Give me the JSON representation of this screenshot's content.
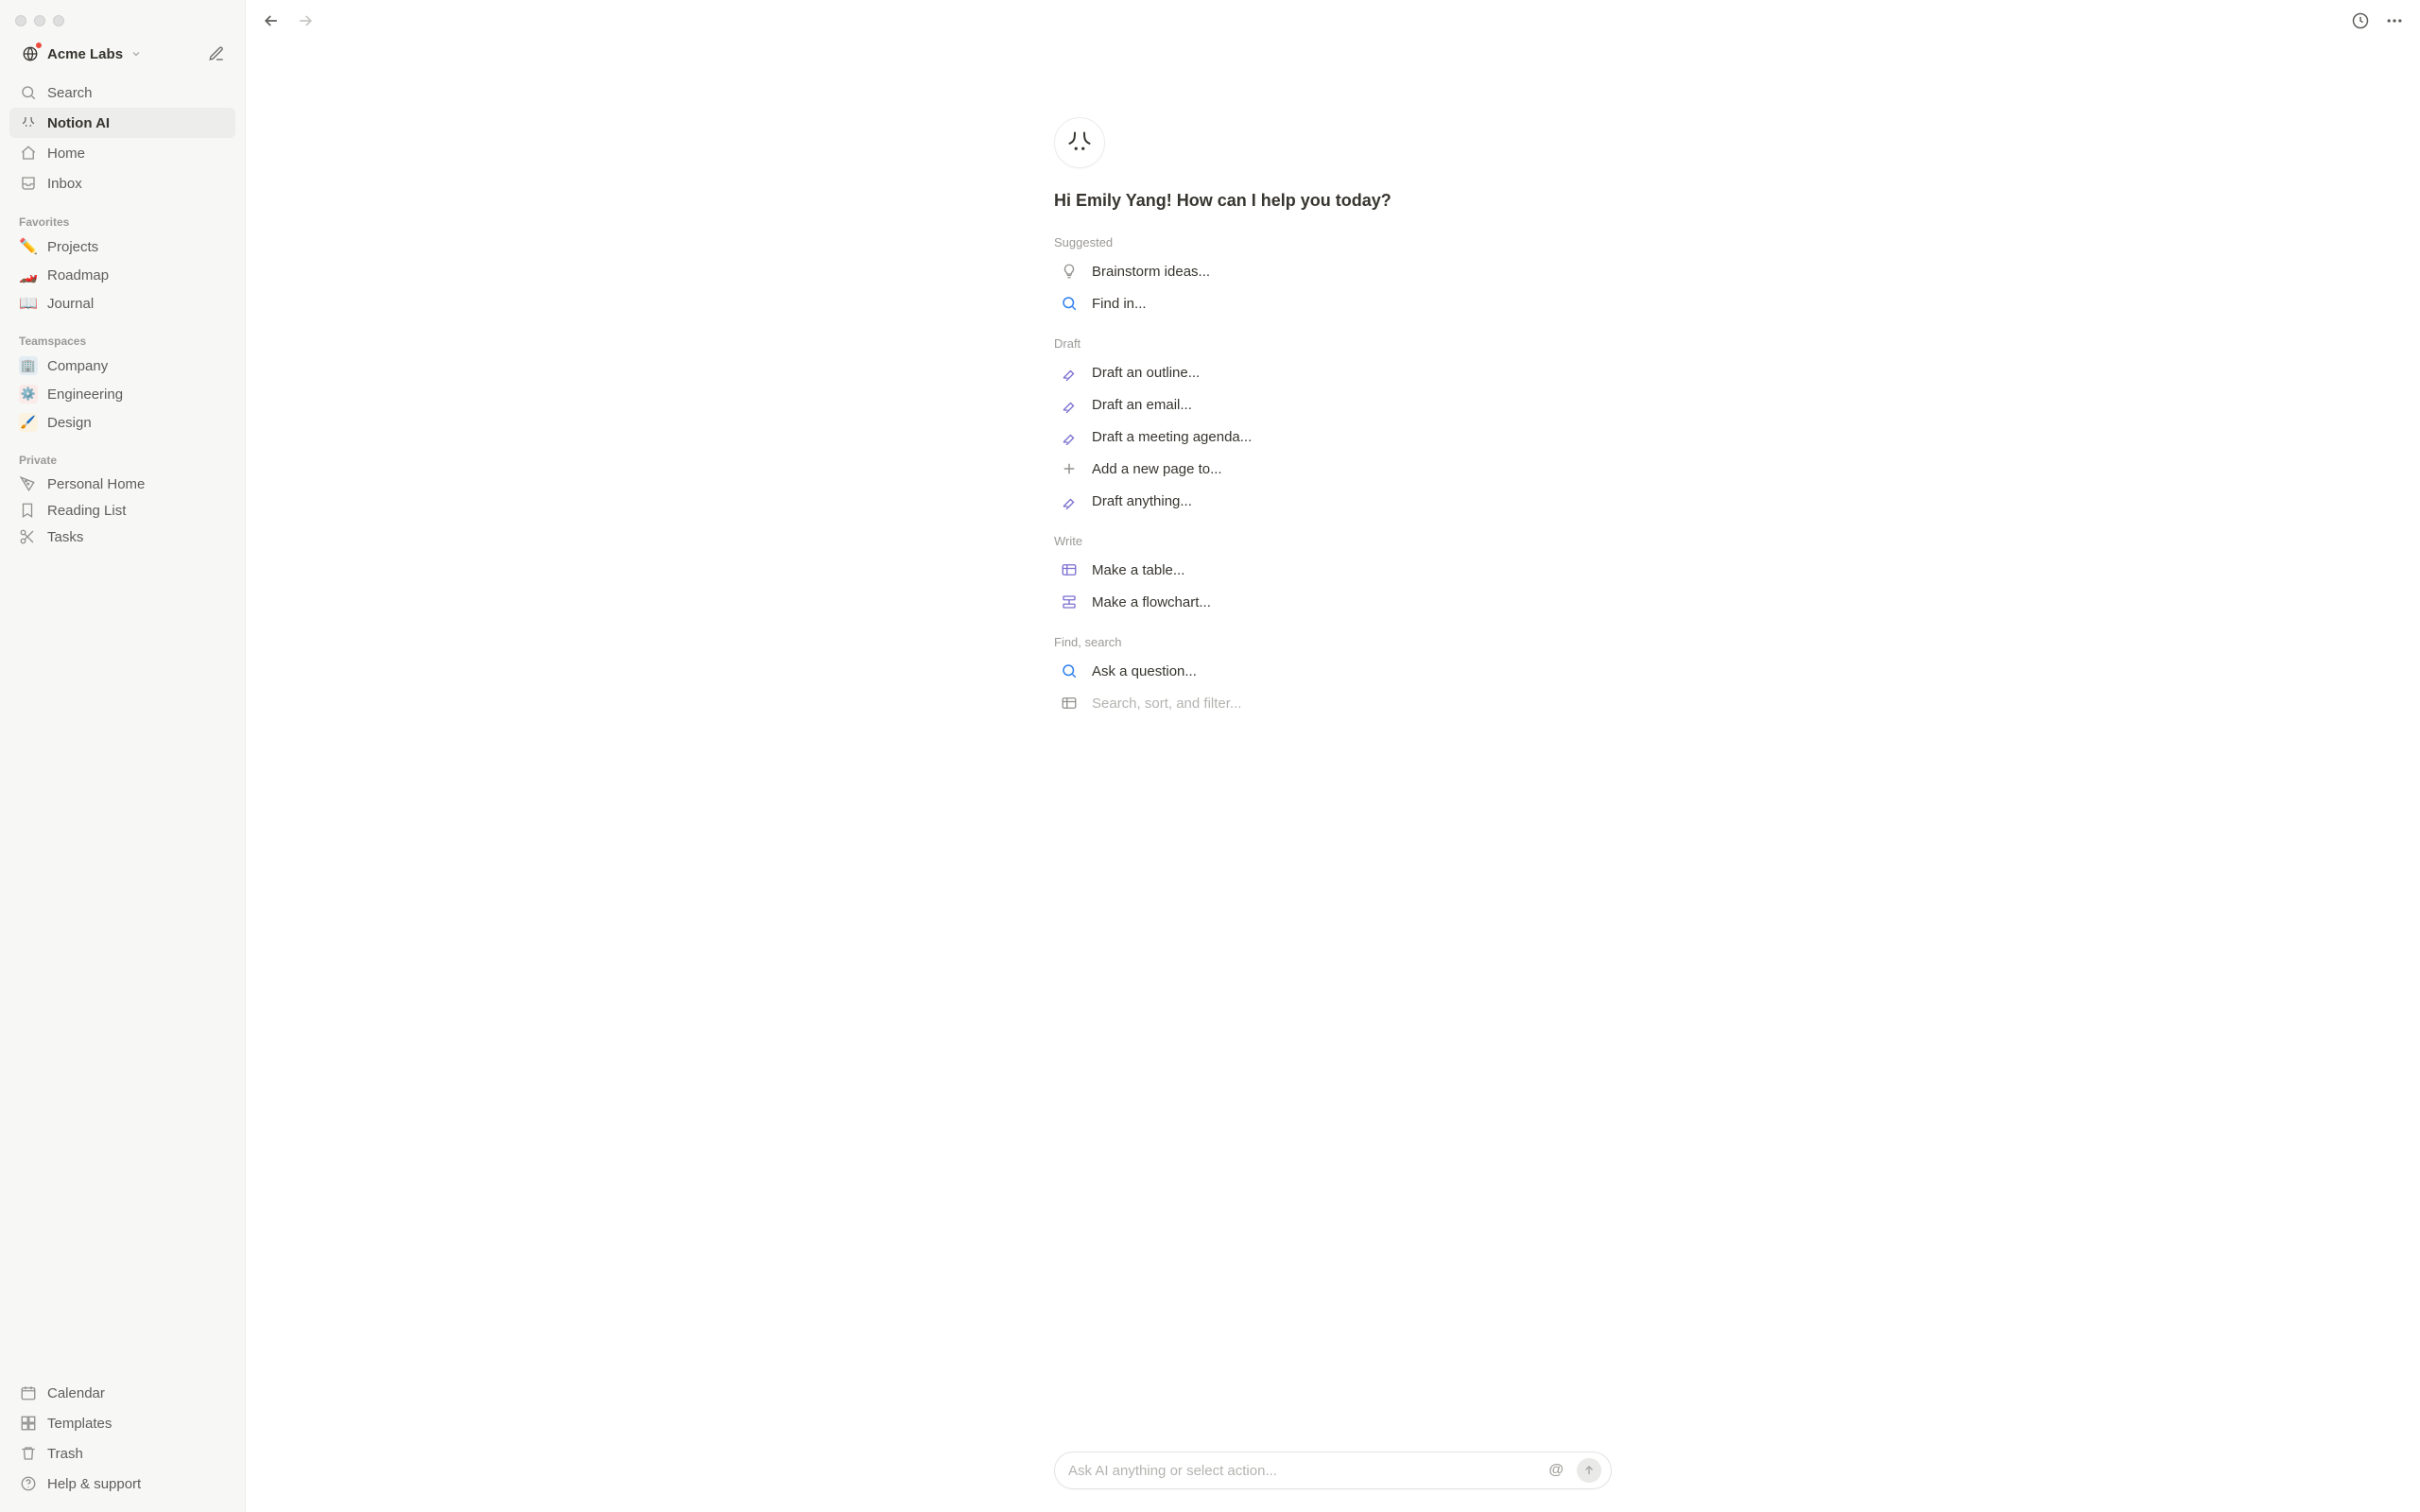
{
  "workspace": {
    "name": "Acme Labs"
  },
  "nav": {
    "search": "Search",
    "ai": "Notion AI",
    "home": "Home",
    "inbox": "Inbox"
  },
  "sections": {
    "favorites": "Favorites",
    "teamspaces": "Teamspaces",
    "private": "Private"
  },
  "favorites": [
    {
      "emoji": "✏️",
      "label": "Projects"
    },
    {
      "emoji": "🏎️",
      "label": "Roadmap"
    },
    {
      "emoji": "📖",
      "label": "Journal"
    }
  ],
  "teamspaces": [
    {
      "emoji": "🏢",
      "tone": "blue",
      "label": "Company"
    },
    {
      "emoji": "⚙️",
      "tone": "red",
      "label": "Engineering"
    },
    {
      "emoji": "🖌️",
      "tone": "yellow",
      "label": "Design"
    }
  ],
  "private": [
    {
      "icon": "pizza",
      "label": "Personal Home"
    },
    {
      "icon": "bookmark",
      "label": "Reading List"
    },
    {
      "icon": "scissors",
      "label": "Tasks"
    }
  ],
  "bottom": {
    "calendar": "Calendar",
    "templates": "Templates",
    "trash": "Trash",
    "help": "Help & support"
  },
  "ai": {
    "greeting": "Hi Emily Yang! How can I help you today?",
    "groups": {
      "suggested": "Suggested",
      "draft": "Draft",
      "write": "Write",
      "find": "Find, search"
    },
    "suggested": [
      {
        "icon": "bulb",
        "label": "Brainstorm ideas..."
      },
      {
        "icon": "search-blue",
        "label": "Find in..."
      }
    ],
    "draft": [
      {
        "icon": "pen-purple",
        "label": "Draft an outline..."
      },
      {
        "icon": "pen-purple",
        "label": "Draft an email..."
      },
      {
        "icon": "pen-purple",
        "label": "Draft a meeting agenda..."
      },
      {
        "icon": "plus",
        "label": "Add a new page to..."
      },
      {
        "icon": "pen-purple",
        "label": "Draft anything..."
      }
    ],
    "write": [
      {
        "icon": "table-purple",
        "label": "Make a table..."
      },
      {
        "icon": "flow-purple",
        "label": "Make a flowchart..."
      }
    ],
    "find": [
      {
        "icon": "search-blue",
        "label": "Ask a question..."
      },
      {
        "icon": "table-gray",
        "label": "Search, sort, and filter...",
        "faded": true
      }
    ],
    "askPlaceholder": "Ask AI anything or select action..."
  }
}
